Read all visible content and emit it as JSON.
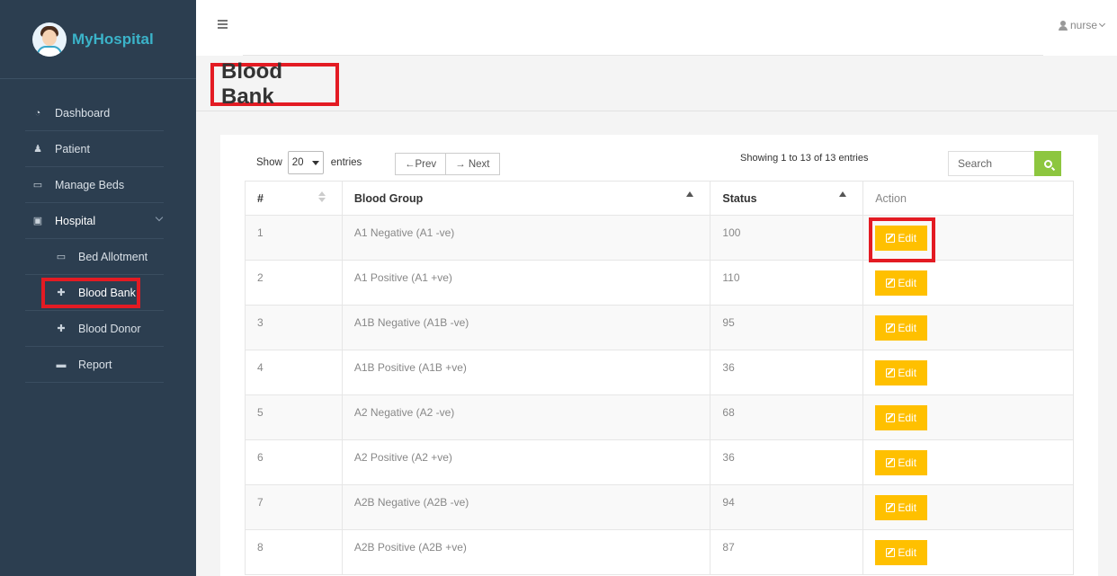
{
  "brand": {
    "name": "MyHospital",
    "logo_icon": "doctor-avatar-icon"
  },
  "sidebar": {
    "items": [
      {
        "label": "Dashboard",
        "icon": "dashboard-icon",
        "glyph": "◔"
      },
      {
        "label": "Patient",
        "icon": "user-icon",
        "glyph": "♟"
      },
      {
        "label": "Manage Beds",
        "icon": "bed-icon",
        "glyph": "▭"
      },
      {
        "label": "Hospital",
        "icon": "hospital-icon",
        "glyph": "▣"
      },
      {
        "label": "Bed Allotment",
        "icon": "bed-icon",
        "glyph": "▭"
      },
      {
        "label": "Blood Bank",
        "icon": "medkit-icon",
        "glyph": "✚"
      },
      {
        "label": "Blood Donor",
        "icon": "medkit-icon",
        "glyph": "✚"
      },
      {
        "label": "Report",
        "icon": "briefcase-icon",
        "glyph": "▬"
      }
    ]
  },
  "topbar": {
    "user": "nurse"
  },
  "page": {
    "title": "Blood Bank"
  },
  "controls": {
    "show_label": "Show",
    "page_size": "20",
    "entries_label": "entries",
    "prev_label": "←Prev",
    "next_label": "→ Next",
    "info": "Showing 1 to 13 of 13 entries",
    "search_placeholder": "Search"
  },
  "table": {
    "headers": [
      "#",
      "Blood Group",
      "Status",
      "Action"
    ],
    "edit_label": "Edit",
    "rows": [
      {
        "num": "1",
        "group": "A1 Negative (A1 -ve)",
        "status": "100"
      },
      {
        "num": "2",
        "group": "A1 Positive (A1 +ve)",
        "status": "110"
      },
      {
        "num": "3",
        "group": "A1B Negative (A1B -ve)",
        "status": "95"
      },
      {
        "num": "4",
        "group": "A1B Positive (A1B +ve)",
        "status": "36"
      },
      {
        "num": "5",
        "group": "A2 Negative (A2 -ve)",
        "status": "68"
      },
      {
        "num": "6",
        "group": "A2 Positive (A2 +ve)",
        "status": "36"
      },
      {
        "num": "7",
        "group": "A2B Negative (A2B -ve)",
        "status": "94"
      },
      {
        "num": "8",
        "group": "A2B Positive (A2B +ve)",
        "status": "87"
      }
    ]
  },
  "colors": {
    "sidebar_bg": "#2c3e50",
    "brand_text": "#3bb3c9",
    "edit_button": "#ffc000",
    "search_button": "#8dc63f",
    "highlight": "#e31b23"
  }
}
